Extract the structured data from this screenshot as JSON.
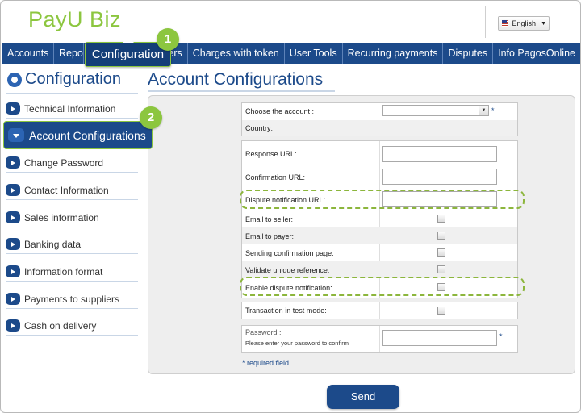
{
  "brand": {
    "logo_text": "PayU Biz"
  },
  "language": {
    "selected": "English"
  },
  "nav": {
    "items": [
      "Accounts",
      "Repor",
      "sers",
      "Charges with token",
      "User Tools",
      "Recurring payments",
      "Disputes",
      "Info PagosOnline"
    ],
    "active_label": "Configuration"
  },
  "callouts": {
    "one": "1",
    "two": "2"
  },
  "sidebar": {
    "title": "Configuration",
    "items": [
      "Technical Information",
      "Account Configurations",
      "Change Password",
      "Contact Information",
      "Sales information",
      "Banking data",
      "Information format",
      "Payments to suppliers",
      "Cash on delivery"
    ]
  },
  "main": {
    "title": "Account Configurations",
    "account": {
      "label": "Choose the account :",
      "value": "",
      "required_mark": "*"
    },
    "country": {
      "label": "Country:"
    },
    "urls": [
      {
        "label": "Response URL:",
        "value": ""
      },
      {
        "label": "Confirmation URL:",
        "value": ""
      },
      {
        "label": "Dispute notification URL:",
        "value": ""
      }
    ],
    "checkboxes": [
      {
        "label": "Email to seller:",
        "checked": false
      },
      {
        "label": "Email to payer:",
        "checked": false
      },
      {
        "label": "Sending confirmation page:",
        "checked": false
      },
      {
        "label": "Validate unique reference:",
        "checked": false
      },
      {
        "label": "Enable dispute notification:",
        "checked": false
      }
    ],
    "test_mode": {
      "label": "Transaction in test mode:",
      "checked": false
    },
    "password": {
      "label": "Password :",
      "hint": "Please enter your password to confirm",
      "value": "",
      "required_mark": "*"
    },
    "required_note": "* required field.",
    "send_label": "Send"
  },
  "colors": {
    "brand_green": "#8cc63f",
    "nav_blue": "#1c4a8a",
    "highlight_dash": "#8cb63c"
  }
}
